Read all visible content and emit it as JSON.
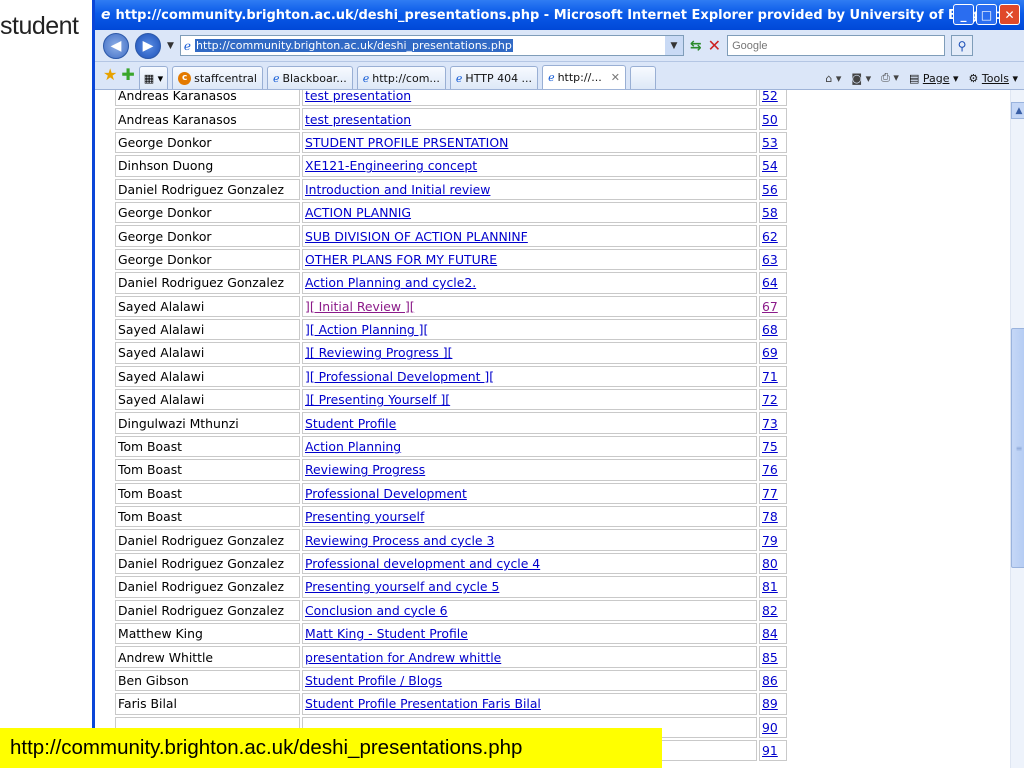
{
  "slide": {
    "title": "student",
    "caption": "http://community.brighton.ac.uk/deshi_presentations.php"
  },
  "window": {
    "title": "http://community.brighton.ac.uk/deshi_presentations.php - Microsoft Internet Explorer provided by University of Brighton",
    "address": "http://community.brighton.ac.uk/deshi_presentations.php",
    "search_placeholder": "Google"
  },
  "tabs": [
    {
      "label": "staffcentral",
      "icon": "staffcentral-icon"
    },
    {
      "label": "Blackboar...",
      "icon": "ie-page-icon"
    },
    {
      "label": "http://com...",
      "icon": "ie-page-icon"
    },
    {
      "label": "HTTP 404 ...",
      "icon": "ie-page-icon"
    },
    {
      "label": "http://...",
      "icon": "ie-page-icon",
      "active": true
    }
  ],
  "commands": {
    "page_label": "Page",
    "tools_label": "Tools"
  },
  "rows": [
    {
      "author": "Andreas Karanasos",
      "title": "test presentation",
      "id": "52"
    },
    {
      "author": "Andreas Karanasos",
      "title": "test presentation",
      "id": "50"
    },
    {
      "author": "George Donkor",
      "title": "STUDENT PROFILE PRSENTATION",
      "id": "53"
    },
    {
      "author": "Dinhson Duong",
      "title": "XE121-Engineering concept",
      "id": "54"
    },
    {
      "author": "Daniel Rodriguez Gonzalez",
      "title": "Introduction and Initial review",
      "id": "56"
    },
    {
      "author": "George Donkor",
      "title": "ACTION PLANNIG",
      "id": "58"
    },
    {
      "author": "George Donkor",
      "title": "SUB DIVISION OF ACTION PLANNINF",
      "id": "62"
    },
    {
      "author": "George Donkor",
      "title": "OTHER PLANS FOR MY FUTURE",
      "id": "63"
    },
    {
      "author": "Daniel Rodriguez Gonzalez",
      "title": "Action Planning and cycle2.",
      "id": "64"
    },
    {
      "author": "Sayed Alalawi",
      "title": "][ Initial Review ][",
      "id": "67",
      "visited": true
    },
    {
      "author": "Sayed Alalawi",
      "title": "][ Action Planning ][",
      "id": "68"
    },
    {
      "author": "Sayed Alalawi",
      "title": "][ Reviewing Progress ][",
      "id": "69"
    },
    {
      "author": "Sayed Alalawi",
      "title": "][ Professional Development ][",
      "id": "71"
    },
    {
      "author": "Sayed Alalawi",
      "title": "][ Presenting Yourself ][",
      "id": "72"
    },
    {
      "author": "Dingulwazi Mthunzi",
      "title": "Student Profile",
      "id": "73"
    },
    {
      "author": "Tom Boast",
      "title": "Action Planning",
      "id": "75"
    },
    {
      "author": "Tom Boast",
      "title": "Reviewing Progress",
      "id": "76"
    },
    {
      "author": "Tom Boast",
      "title": "Professional Development",
      "id": "77"
    },
    {
      "author": "Tom Boast",
      "title": "Presenting yourself",
      "id": "78"
    },
    {
      "author": "Daniel Rodriguez Gonzalez",
      "title": "Reviewing Process and cycle 3",
      "id": "79"
    },
    {
      "author": "Daniel Rodriguez Gonzalez",
      "title": "Professional development and cycle 4",
      "id": "80"
    },
    {
      "author": "Daniel Rodriguez Gonzalez",
      "title": "Presenting yourself and cycle 5",
      "id": "81"
    },
    {
      "author": "Daniel Rodriguez Gonzalez",
      "title": "Conclusion and cycle 6",
      "id": "82"
    },
    {
      "author": "Matthew King",
      "title": "Matt King - Student Profile",
      "id": "84"
    },
    {
      "author": "Andrew Whittle",
      "title": "presentation for Andrew whittle",
      "id": "85"
    },
    {
      "author": "Ben Gibson",
      "title": "Student Profile / Blogs",
      "id": "86"
    },
    {
      "author": "Faris Bilal",
      "title": "Student Profile Presentation  Faris Bilal",
      "id": "89"
    },
    {
      "author": "",
      "title": "",
      "id": "90"
    },
    {
      "author": "",
      "title": "",
      "id": "91"
    }
  ]
}
